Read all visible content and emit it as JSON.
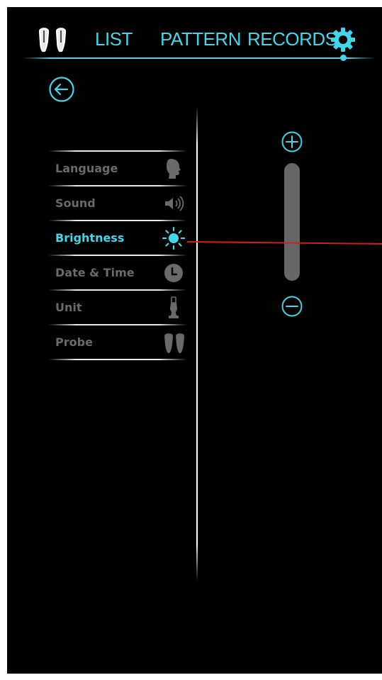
{
  "nav": {
    "tabs": [
      {
        "label": "LIST"
      },
      {
        "label": "PATTERN"
      },
      {
        "label": "RECORDS"
      }
    ],
    "accent_color": "#3fd7ea",
    "settings_icon": "gear-icon",
    "probe_icon": "earbud-pair-icon"
  },
  "back": {
    "icon": "back-arrow-icon"
  },
  "settings_menu": {
    "items": [
      {
        "label": "Language",
        "icon": "speaking-head-icon",
        "active": false
      },
      {
        "label": "Sound",
        "icon": "speaker-icon",
        "active": false
      },
      {
        "label": "Brightness",
        "icon": "sun-icon",
        "active": true
      },
      {
        "label": "Date & Time",
        "icon": "clock-icon",
        "active": false
      },
      {
        "label": "Unit",
        "icon": "probe-device-icon",
        "active": false
      },
      {
        "label": "Probe",
        "icon": "earbud-probe-icon",
        "active": false
      }
    ],
    "active_color": "#3fd7ea",
    "inactive_color": "#6a6a6a"
  },
  "brightness": {
    "increase_icon": "plus-circle-icon",
    "decrease_icon": "minus-circle-icon",
    "track_color": "#666666"
  },
  "annotation_color": "#d81a1a"
}
